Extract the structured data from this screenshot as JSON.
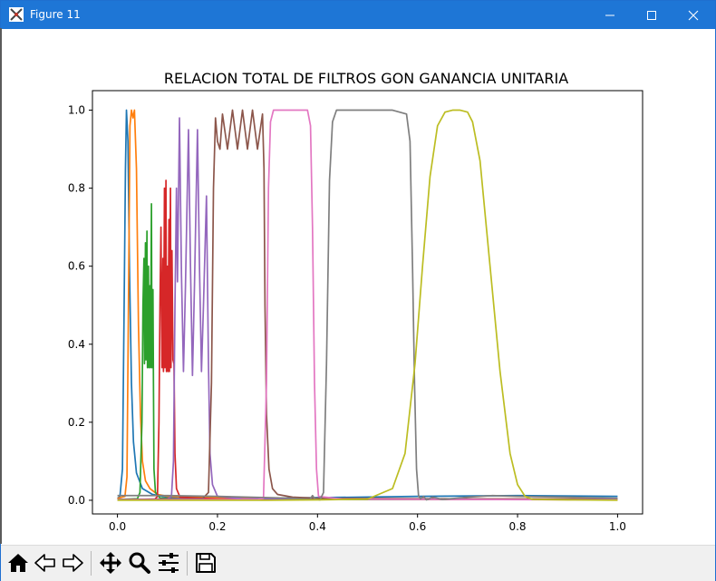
{
  "window": {
    "title": "Figure 11",
    "controls": {
      "minimize": "minimize",
      "maximize": "maximize",
      "close": "close"
    }
  },
  "toolbar": {
    "buttons": [
      {
        "name": "home-button",
        "icon": "home-icon"
      },
      {
        "name": "back-button",
        "icon": "arrow-left-icon"
      },
      {
        "name": "forward-button",
        "icon": "arrow-right-icon"
      },
      {
        "name": "pan-button",
        "icon": "move-icon"
      },
      {
        "name": "zoom-button",
        "icon": "magnifier-icon"
      },
      {
        "name": "configure-subplots-button",
        "icon": "sliders-icon"
      },
      {
        "name": "save-button",
        "icon": "floppy-disk-icon"
      }
    ]
  },
  "chart_data": {
    "type": "line",
    "title": "RELACION TOTAL DE FILTROS GON GANANCIA UNITARIA",
    "xlabel": "",
    "ylabel": "",
    "xlim": [
      -0.05,
      1.05
    ],
    "ylim": [
      -0.035,
      1.05
    ],
    "xticks": [
      "0.0",
      "0.2",
      "0.4",
      "0.6",
      "0.8",
      "1.0"
    ],
    "yticks": [
      "0.0",
      "0.2",
      "0.4",
      "0.6",
      "0.8",
      "1.0"
    ],
    "grid": false,
    "series": [
      {
        "color": "#1f77b4",
        "points": [
          [
            0,
            0.005
          ],
          [
            0.005,
            0.01
          ],
          [
            0.01,
            0.08
          ],
          [
            0.013,
            0.45
          ],
          [
            0.016,
            0.85
          ],
          [
            0.018,
            1.0
          ],
          [
            0.021,
            0.92
          ],
          [
            0.024,
            0.6
          ],
          [
            0.028,
            0.3
          ],
          [
            0.032,
            0.15
          ],
          [
            0.038,
            0.07
          ],
          [
            0.05,
            0.03
          ],
          [
            0.07,
            0.015
          ],
          [
            0.1,
            0.008
          ],
          [
            0.3,
            0.005
          ],
          [
            0.6,
            0.01
          ],
          [
            0.8,
            0.012
          ],
          [
            1.0,
            0.01
          ]
        ]
      },
      {
        "color": "#ff7f0e",
        "points": [
          [
            0,
            0.005
          ],
          [
            0.015,
            0.01
          ],
          [
            0.019,
            0.06
          ],
          [
            0.022,
            0.5
          ],
          [
            0.025,
            0.96
          ],
          [
            0.028,
            1.0
          ],
          [
            0.031,
            0.98
          ],
          [
            0.034,
            1.0
          ],
          [
            0.038,
            0.85
          ],
          [
            0.042,
            0.45
          ],
          [
            0.046,
            0.22
          ],
          [
            0.05,
            0.1
          ],
          [
            0.056,
            0.05
          ],
          [
            0.065,
            0.03
          ],
          [
            0.08,
            0.015
          ],
          [
            0.1,
            0.01
          ],
          [
            0.2,
            0.006
          ],
          [
            0.5,
            0.004
          ],
          [
            1.0,
            0.003
          ]
        ]
      },
      {
        "color": "#2ca02c",
        "points": [
          [
            0,
            0.002
          ],
          [
            0.04,
            0.004
          ],
          [
            0.045,
            0.02
          ],
          [
            0.049,
            0.2
          ],
          [
            0.051,
            0.5
          ],
          [
            0.053,
            0.62
          ],
          [
            0.054,
            0.35
          ],
          [
            0.056,
            0.66
          ],
          [
            0.057,
            0.36
          ],
          [
            0.059,
            0.69
          ],
          [
            0.06,
            0.34
          ],
          [
            0.062,
            0.6
          ],
          [
            0.063,
            0.34
          ],
          [
            0.065,
            0.55
          ],
          [
            0.066,
            0.34
          ],
          [
            0.068,
            0.76
          ],
          [
            0.069,
            0.34
          ],
          [
            0.071,
            0.54
          ],
          [
            0.072,
            0.3
          ],
          [
            0.073,
            0.08
          ],
          [
            0.076,
            0.02
          ],
          [
            0.085,
            0.006
          ],
          [
            0.12,
            0.003
          ],
          [
            0.5,
            0.002
          ],
          [
            1.0,
            0.002
          ]
        ]
      },
      {
        "color": "#d62728",
        "points": [
          [
            0,
            0.001
          ],
          [
            0.075,
            0.003
          ],
          [
            0.08,
            0.01
          ],
          [
            0.083,
            0.2
          ],
          [
            0.085,
            0.5
          ],
          [
            0.087,
            0.7
          ],
          [
            0.089,
            0.34
          ],
          [
            0.091,
            0.62
          ],
          [
            0.092,
            0.33
          ],
          [
            0.094,
            0.8
          ],
          [
            0.095,
            0.34
          ],
          [
            0.097,
            0.82
          ],
          [
            0.098,
            0.33
          ],
          [
            0.1,
            0.6
          ],
          [
            0.101,
            0.33
          ],
          [
            0.103,
            0.72
          ],
          [
            0.104,
            0.33
          ],
          [
            0.106,
            0.8
          ],
          [
            0.107,
            0.34
          ],
          [
            0.109,
            0.64
          ],
          [
            0.111,
            0.36
          ],
          [
            0.113,
            0.35
          ],
          [
            0.115,
            0.12
          ],
          [
            0.118,
            0.03
          ],
          [
            0.125,
            0.008
          ],
          [
            0.2,
            0.003
          ],
          [
            1.0,
            0.002
          ]
        ]
      },
      {
        "color": "#9467bd",
        "points": [
          [
            0,
            0.001
          ],
          [
            0.1,
            0.003
          ],
          [
            0.108,
            0.01
          ],
          [
            0.112,
            0.1
          ],
          [
            0.115,
            0.5
          ],
          [
            0.118,
            0.8
          ],
          [
            0.12,
            0.56
          ],
          [
            0.124,
            0.98
          ],
          [
            0.128,
            0.58
          ],
          [
            0.132,
            0.33
          ],
          [
            0.136,
            0.55
          ],
          [
            0.142,
            0.95
          ],
          [
            0.146,
            0.6
          ],
          [
            0.15,
            0.32
          ],
          [
            0.154,
            0.55
          ],
          [
            0.16,
            0.95
          ],
          [
            0.164,
            0.6
          ],
          [
            0.168,
            0.33
          ],
          [
            0.172,
            0.5
          ],
          [
            0.178,
            0.78
          ],
          [
            0.182,
            0.35
          ],
          [
            0.185,
            0.12
          ],
          [
            0.19,
            0.04
          ],
          [
            0.2,
            0.01
          ],
          [
            0.25,
            0.004
          ],
          [
            1.0,
            0.002
          ]
        ]
      },
      {
        "color": "#8c564b",
        "points": [
          [
            0,
            0.002
          ],
          [
            0.17,
            0.004
          ],
          [
            0.182,
            0.02
          ],
          [
            0.188,
            0.3
          ],
          [
            0.192,
            0.8
          ],
          [
            0.196,
            0.98
          ],
          [
            0.2,
            0.92
          ],
          [
            0.205,
            0.9
          ],
          [
            0.21,
            0.99
          ],
          [
            0.22,
            0.9
          ],
          [
            0.23,
            1.0
          ],
          [
            0.24,
            0.9
          ],
          [
            0.25,
            1.0
          ],
          [
            0.26,
            0.9
          ],
          [
            0.27,
            1.0
          ],
          [
            0.28,
            0.9
          ],
          [
            0.29,
            0.99
          ],
          [
            0.293,
            0.85
          ],
          [
            0.295,
            0.5
          ],
          [
            0.298,
            0.22
          ],
          [
            0.303,
            0.08
          ],
          [
            0.31,
            0.03
          ],
          [
            0.32,
            0.015
          ],
          [
            0.35,
            0.008
          ],
          [
            0.4,
            0.005
          ],
          [
            0.6,
            0.004
          ],
          [
            1.0,
            0.003
          ]
        ]
      },
      {
        "color": "#e377c2",
        "points": [
          [
            0,
            0.001
          ],
          [
            0.28,
            0.002
          ],
          [
            0.292,
            0.005
          ],
          [
            0.298,
            0.3
          ],
          [
            0.302,
            0.8
          ],
          [
            0.306,
            0.97
          ],
          [
            0.312,
            1.0
          ],
          [
            0.38,
            1.0
          ],
          [
            0.386,
            0.96
          ],
          [
            0.39,
            0.7
          ],
          [
            0.394,
            0.3
          ],
          [
            0.398,
            0.08
          ],
          [
            0.402,
            0.01
          ],
          [
            0.45,
            0.003
          ],
          [
            1.0,
            0.001
          ]
        ]
      },
      {
        "color": "#7f7f7f",
        "points": [
          [
            0,
            0.012
          ],
          [
            0.1,
            0.012
          ],
          [
            0.2,
            0.01
          ],
          [
            0.3,
            0.007
          ],
          [
            0.35,
            0.005
          ],
          [
            0.385,
            0.002
          ],
          [
            0.39,
            0.012
          ],
          [
            0.395,
            0.003
          ],
          [
            0.405,
            0.001
          ],
          [
            0.412,
            0.02
          ],
          [
            0.418,
            0.35
          ],
          [
            0.424,
            0.82
          ],
          [
            0.43,
            0.97
          ],
          [
            0.438,
            1.0
          ],
          [
            0.55,
            1.0
          ],
          [
            0.578,
            0.99
          ],
          [
            0.585,
            0.92
          ],
          [
            0.59,
            0.6
          ],
          [
            0.594,
            0.3
          ],
          [
            0.598,
            0.08
          ],
          [
            0.602,
            0.012
          ],
          [
            0.606,
            0.004
          ],
          [
            0.612,
            0.01
          ],
          [
            0.618,
            0.001
          ],
          [
            0.63,
            0.008
          ],
          [
            0.65,
            0.002
          ],
          [
            0.7,
            0.008
          ],
          [
            0.75,
            0.012
          ],
          [
            0.8,
            0.01
          ],
          [
            0.9,
            0.008
          ],
          [
            1.0,
            0.005
          ]
        ]
      },
      {
        "color": "#bcbd22",
        "points": [
          [
            0,
            0.0
          ],
          [
            0.3,
            0.0
          ],
          [
            0.4,
            0.001
          ],
          [
            0.5,
            0.003
          ],
          [
            0.55,
            0.03
          ],
          [
            0.575,
            0.12
          ],
          [
            0.595,
            0.35
          ],
          [
            0.61,
            0.6
          ],
          [
            0.625,
            0.83
          ],
          [
            0.64,
            0.96
          ],
          [
            0.655,
            0.995
          ],
          [
            0.67,
            1.0
          ],
          [
            0.685,
            1.0
          ],
          [
            0.7,
            0.995
          ],
          [
            0.71,
            0.97
          ],
          [
            0.725,
            0.87
          ],
          [
            0.745,
            0.6
          ],
          [
            0.765,
            0.33
          ],
          [
            0.785,
            0.12
          ],
          [
            0.8,
            0.04
          ],
          [
            0.815,
            0.01
          ],
          [
            0.83,
            0.002
          ],
          [
            0.9,
            0.001
          ],
          [
            1.0,
            0.0
          ]
        ]
      }
    ]
  }
}
